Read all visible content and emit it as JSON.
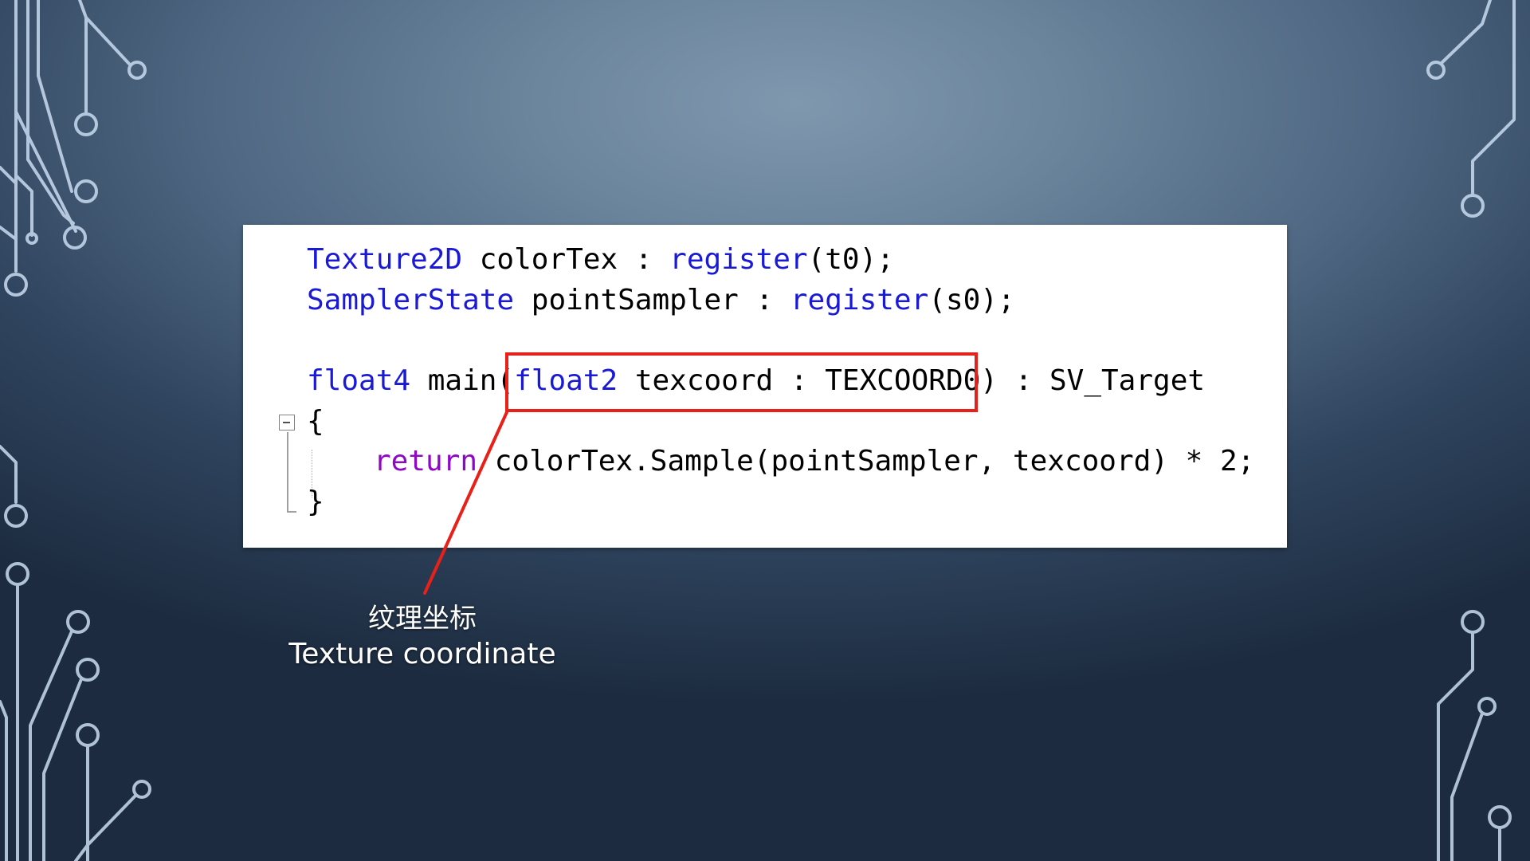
{
  "code": {
    "line1": {
      "type": "Texture2D",
      "rest1": " colorTex : ",
      "fn": "register",
      "rest2": "(t0);"
    },
    "line2": {
      "type": "SamplerState",
      "rest1": " pointSampler : ",
      "fn": "register",
      "rest2": "(s0);"
    },
    "line3": {
      "type": "float4",
      "rest1": " main(",
      "param_type": "float2",
      "rest2": " texcoord : TEXCOORD0) : SV_Target"
    },
    "line4": {
      "text": "{"
    },
    "line5": {
      "keyword": "return",
      "rest": " colorTex.Sample(pointSampler, texcoord) * 2;"
    },
    "line6": {
      "text": "}"
    }
  },
  "annotation": {
    "label_cn": "纹理坐标",
    "label_en": "Texture coordinate",
    "box_color": "#e8201a"
  },
  "icons": {
    "fold": "collapse-minus-icon"
  },
  "colors": {
    "type_keyword": "#1a1ad6",
    "control_keyword": "#8f08c4",
    "background": "#4f6782",
    "circuit_lines": "#c9dcf0"
  }
}
